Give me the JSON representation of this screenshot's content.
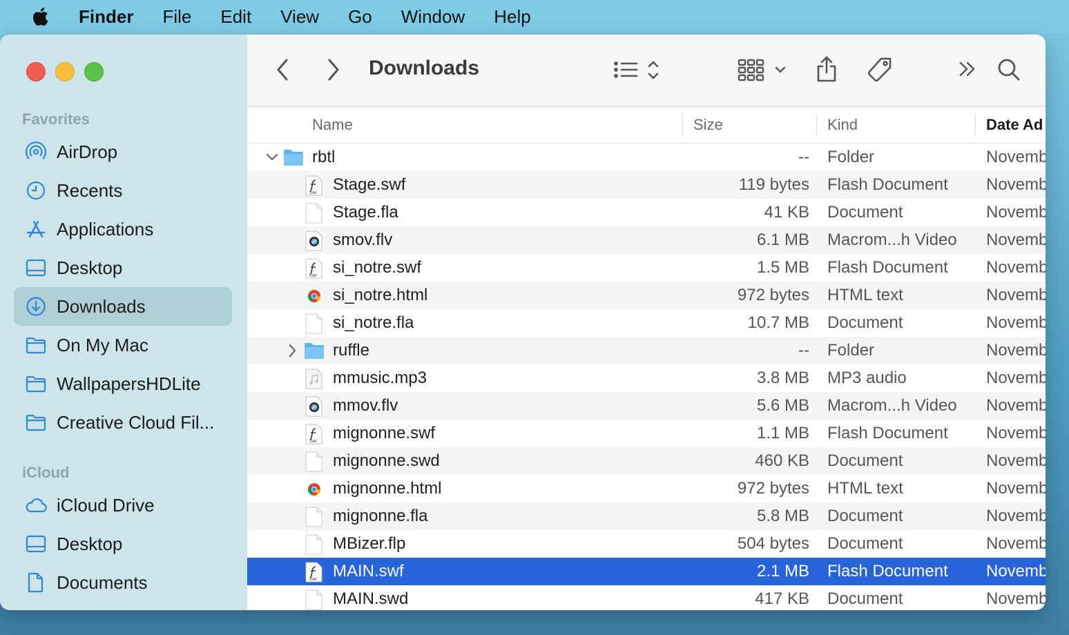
{
  "menubar": {
    "apple_icon": "apple-logo",
    "app_name": "Finder",
    "items": [
      "File",
      "Edit",
      "View",
      "Go",
      "Window",
      "Help"
    ]
  },
  "window": {
    "title": "Downloads"
  },
  "sidebar": {
    "favorites_label": "Favorites",
    "favorites": [
      {
        "label": "AirDrop",
        "icon": "airdrop-icon"
      },
      {
        "label": "Recents",
        "icon": "clock-icon"
      },
      {
        "label": "Applications",
        "icon": "applications-icon"
      },
      {
        "label": "Desktop",
        "icon": "desktop-icon"
      },
      {
        "label": "Downloads",
        "icon": "download-icon",
        "selected": true
      },
      {
        "label": "On My Mac",
        "icon": "folder-icon"
      },
      {
        "label": "WallpapersHDLite",
        "icon": "folder-icon"
      },
      {
        "label": "Creative Cloud Fil...",
        "icon": "folder-icon"
      }
    ],
    "icloud_label": "iCloud",
    "icloud": [
      {
        "label": "iCloud Drive",
        "icon": "cloud-icon"
      },
      {
        "label": "Desktop",
        "icon": "desktop-icon"
      },
      {
        "label": "Documents",
        "icon": "document-icon"
      }
    ]
  },
  "columns": {
    "name": "Name",
    "size": "Size",
    "kind": "Kind",
    "date": "Date Ad"
  },
  "files": [
    {
      "name": "rbtl",
      "size": "--",
      "kind": "Folder",
      "date": "Novemb",
      "type": "folder",
      "expanded": true,
      "level": 0
    },
    {
      "name": "Stage.swf",
      "size": "119 bytes",
      "kind": "Flash Document",
      "date": "Novemb",
      "type": "swf",
      "level": 1
    },
    {
      "name": "Stage.fla",
      "size": "41 KB",
      "kind": "Document",
      "date": "Novemb",
      "type": "doc",
      "level": 1
    },
    {
      "name": "smov.flv",
      "size": "6.1 MB",
      "kind": "Macrom...h Video",
      "date": "Novemb",
      "type": "flv",
      "level": 1
    },
    {
      "name": "si_notre.swf",
      "size": "1.5 MB",
      "kind": "Flash Document",
      "date": "Novemb",
      "type": "swf",
      "level": 1
    },
    {
      "name": "si_notre.html",
      "size": "972 bytes",
      "kind": "HTML text",
      "date": "Novemb",
      "type": "html",
      "level": 1
    },
    {
      "name": "si_notre.fla",
      "size": "10.7 MB",
      "kind": "Document",
      "date": "Novemb",
      "type": "doc",
      "level": 1
    },
    {
      "name": "ruffle",
      "size": "--",
      "kind": "Folder",
      "date": "Novemb",
      "type": "folder",
      "expanded": false,
      "level": 1
    },
    {
      "name": "mmusic.mp3",
      "size": "3.8 MB",
      "kind": "MP3 audio",
      "date": "Novemb",
      "type": "mp3",
      "level": 1
    },
    {
      "name": "mmov.flv",
      "size": "5.6 MB",
      "kind": "Macrom...h Video",
      "date": "Novemb",
      "type": "flv",
      "level": 1
    },
    {
      "name": "mignonne.swf",
      "size": "1.1 MB",
      "kind": "Flash Document",
      "date": "Novemb",
      "type": "swf",
      "level": 1
    },
    {
      "name": "mignonne.swd",
      "size": "460 KB",
      "kind": "Document",
      "date": "Novemb",
      "type": "doc",
      "level": 1
    },
    {
      "name": "mignonne.html",
      "size": "972 bytes",
      "kind": "HTML text",
      "date": "Novemb",
      "type": "html",
      "level": 1
    },
    {
      "name": "mignonne.fla",
      "size": "5.8 MB",
      "kind": "Document",
      "date": "Novemb",
      "type": "doc",
      "level": 1
    },
    {
      "name": "MBizer.flp",
      "size": "504 bytes",
      "kind": "Document",
      "date": "Novemb",
      "type": "doc",
      "level": 1
    },
    {
      "name": "MAIN.swf",
      "size": "2.1 MB",
      "kind": "Flash Document",
      "date": "Novemb",
      "type": "swf",
      "level": 1,
      "selected": true
    },
    {
      "name": "MAIN.swd",
      "size": "417 KB",
      "kind": "Document",
      "date": "Novemb",
      "type": "doc",
      "level": 1
    }
  ],
  "colors": {
    "accent": "#2963d9",
    "sidebar_icon": "#2f86d6",
    "folder": "#5ab3ea"
  }
}
